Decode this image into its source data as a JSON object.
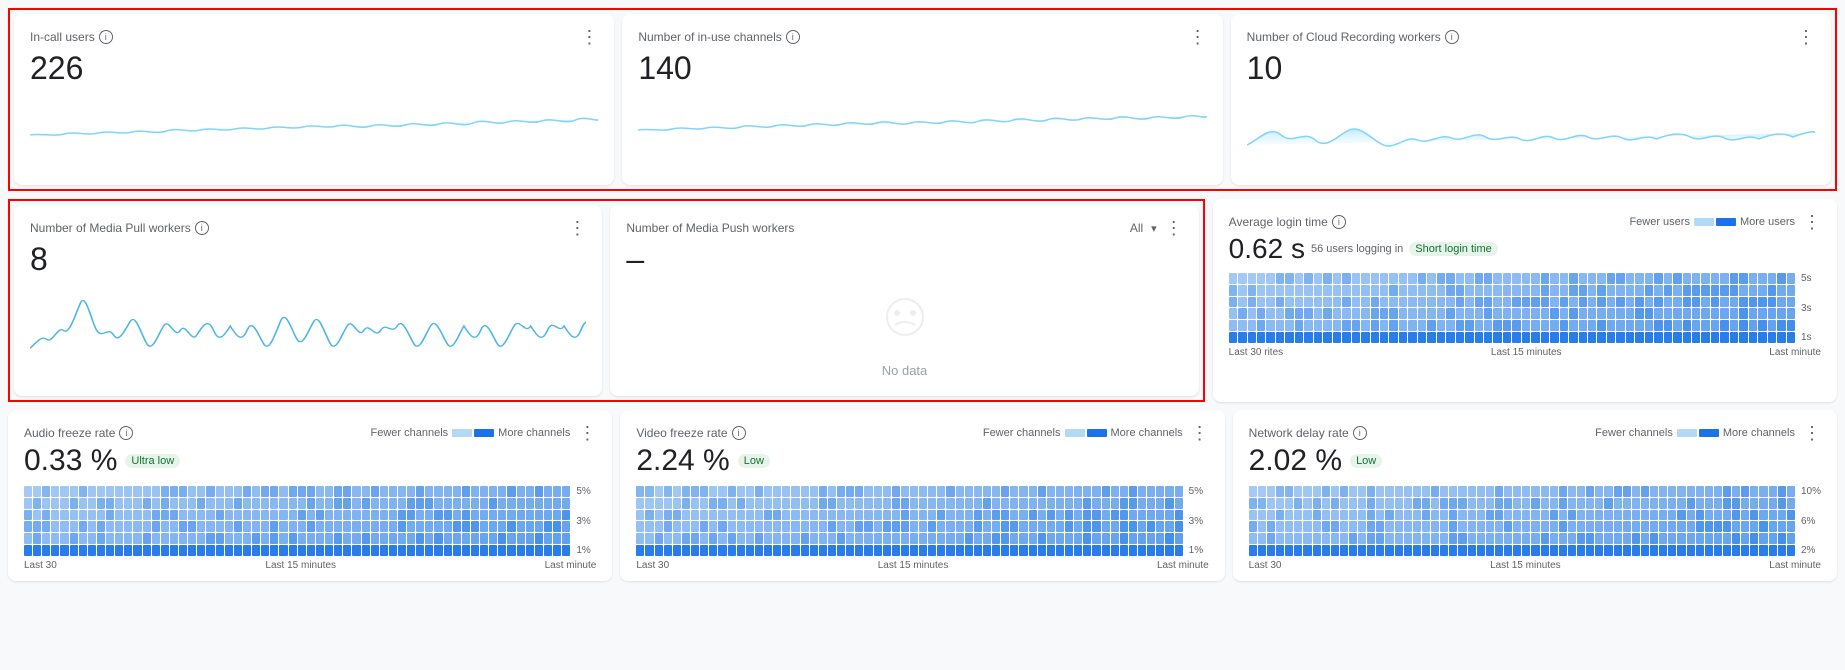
{
  "cards": {
    "in_call_users": {
      "title": "In-call users",
      "value": "226",
      "menu": "⋮"
    },
    "in_use_channels": {
      "title": "Number of in-use channels",
      "value": "140",
      "menu": "⋮"
    },
    "cloud_recording": {
      "title": "Number of Cloud Recording workers",
      "value": "10",
      "menu": "⋮"
    },
    "media_pull": {
      "title": "Number of Media Pull workers",
      "value": "8",
      "menu": "⋮"
    },
    "media_push": {
      "title": "Number of Media Push workers",
      "value": "–",
      "filter": "All",
      "menu": "⋮",
      "no_data": "No data"
    },
    "avg_login": {
      "title": "Average login time",
      "value": "0.62 s",
      "sub_label": "56 users logging in",
      "badge": "Short login time",
      "fewer_label": "Fewer users",
      "more_label": "More users",
      "menu": "⋮",
      "y_labels": [
        "5s",
        "3s",
        "1s"
      ],
      "x_labels": [
        "Last 30 rites",
        "Last 15 minutes",
        "Last minute"
      ]
    },
    "audio_freeze": {
      "title": "Audio freeze rate",
      "value": "0.33 %",
      "badge": "Ultra low",
      "fewer_label": "Fewer channels",
      "more_label": "More channels",
      "menu": "⋮",
      "y_labels": [
        "5%",
        "3%",
        "1%"
      ],
      "x_labels": [
        "Last 30",
        "Last 15 minutes",
        "Last minute"
      ]
    },
    "video_freeze": {
      "title": "Video freeze rate",
      "value": "2.24 %",
      "badge": "Low",
      "fewer_label": "Fewer channels",
      "more_label": "More channels",
      "menu": "⋮",
      "y_labels": [
        "5%",
        "3%",
        "1%"
      ],
      "x_labels": [
        "Last 30",
        "Last 15 minutes",
        "Last minute"
      ]
    },
    "network_delay": {
      "title": "Network delay rate",
      "value": "2.02 %",
      "badge": "Low",
      "fewer_label": "Fewer channels",
      "more_label": "More channels",
      "menu": "⋮",
      "y_labels": [
        "10%",
        "6%",
        "2%"
      ],
      "x_labels": [
        "Last 30",
        "Last 15 minutes",
        "Last minute"
      ]
    }
  }
}
